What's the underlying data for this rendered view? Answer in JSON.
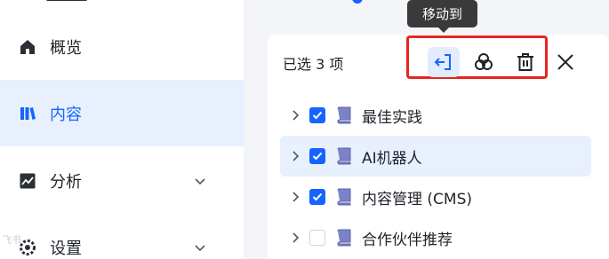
{
  "sidebar": {
    "items": [
      {
        "label": "概览",
        "icon": "home-icon",
        "active": false
      },
      {
        "label": "内容",
        "icon": "library-icon",
        "active": true
      },
      {
        "label": "分析",
        "icon": "chart-icon",
        "active": false
      },
      {
        "label": "设置",
        "icon": "gear-icon",
        "active": false
      }
    ]
  },
  "watermark": "飞书",
  "tooltip": {
    "label": "移动到"
  },
  "selection": {
    "count_label": "已选 3 项"
  },
  "toolbar": {
    "move_icon": "move-to-icon",
    "merge_icon": "merge-icon",
    "delete_icon": "trash-icon",
    "close_icon": "close-icon",
    "highlight_color": "#e8251d"
  },
  "colors": {
    "accent": "#1664ff",
    "book": "#7b83c8",
    "hover_row": "#e8f0fd"
  },
  "tree": {
    "rows": [
      {
        "title": "最佳实践",
        "checked": true
      },
      {
        "title": "AI机器人",
        "checked": true
      },
      {
        "title": "内容管理 (CMS)",
        "checked": true
      },
      {
        "title": "合作伙伴推荐",
        "checked": false
      }
    ]
  }
}
